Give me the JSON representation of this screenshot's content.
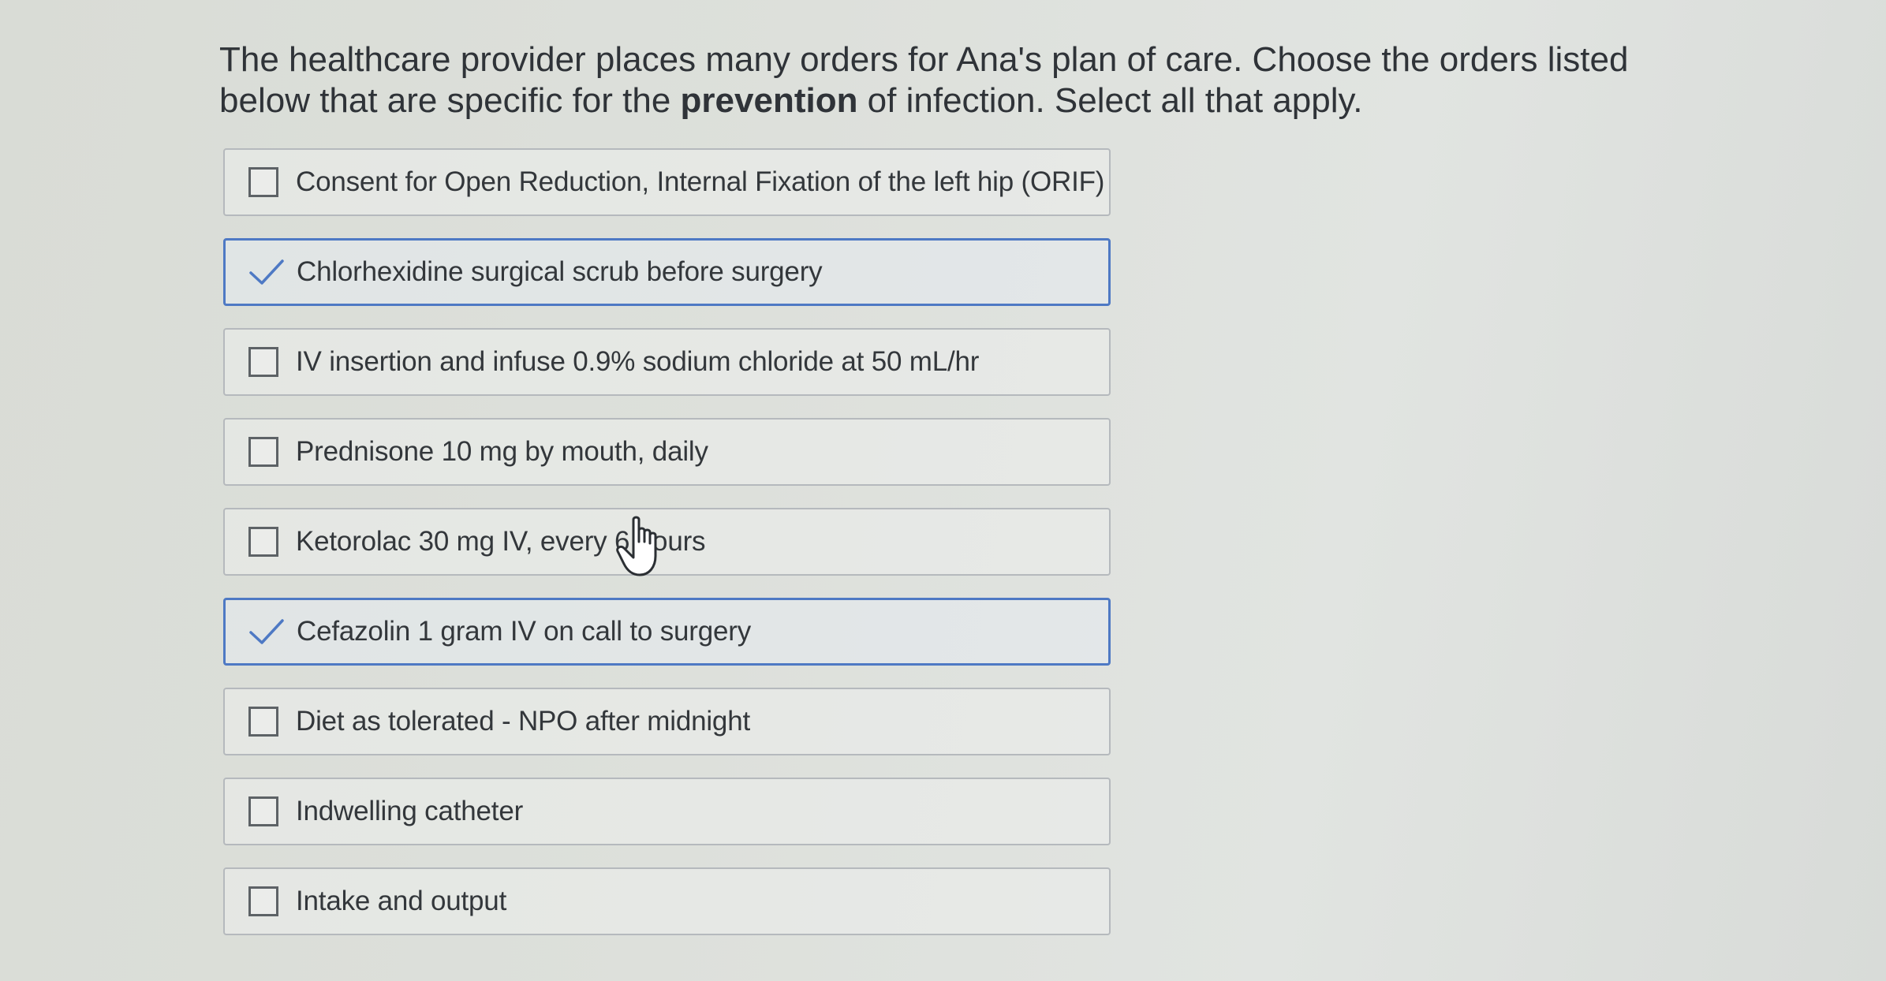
{
  "question": {
    "part1": "The healthcare provider places many orders for Ana's plan of care. Choose the orders listed below that are specific for the ",
    "bold": "prevention",
    "part2": " of infection. Select all that apply."
  },
  "options": [
    {
      "label": "Consent for Open Reduction, Internal Fixation of the left hip (ORIF)",
      "checked": false
    },
    {
      "label": "Chlorhexidine surgical scrub before surgery",
      "checked": true
    },
    {
      "label": "IV insertion and infuse 0.9% sodium chloride at 50 mL/hr",
      "checked": false
    },
    {
      "label": "Prednisone 10 mg by mouth, daily",
      "checked": false
    },
    {
      "label": "Ketorolac 30 mg IV, every 6 hours",
      "checked": false
    },
    {
      "label": "Cefazolin 1 gram IV on call to surgery",
      "checked": true
    },
    {
      "label": "Diet as tolerated - NPO after midnight",
      "checked": false
    },
    {
      "label": "Indwelling catheter",
      "checked": false
    },
    {
      "label": "Intake and output",
      "checked": false
    }
  ],
  "colors": {
    "selected_border": "#4e79c4",
    "check_mark": "#4e79c4"
  },
  "icons": {
    "checked": "checkmark-icon",
    "unchecked": "empty-checkbox",
    "pointer": "hand-pointer-icon"
  }
}
